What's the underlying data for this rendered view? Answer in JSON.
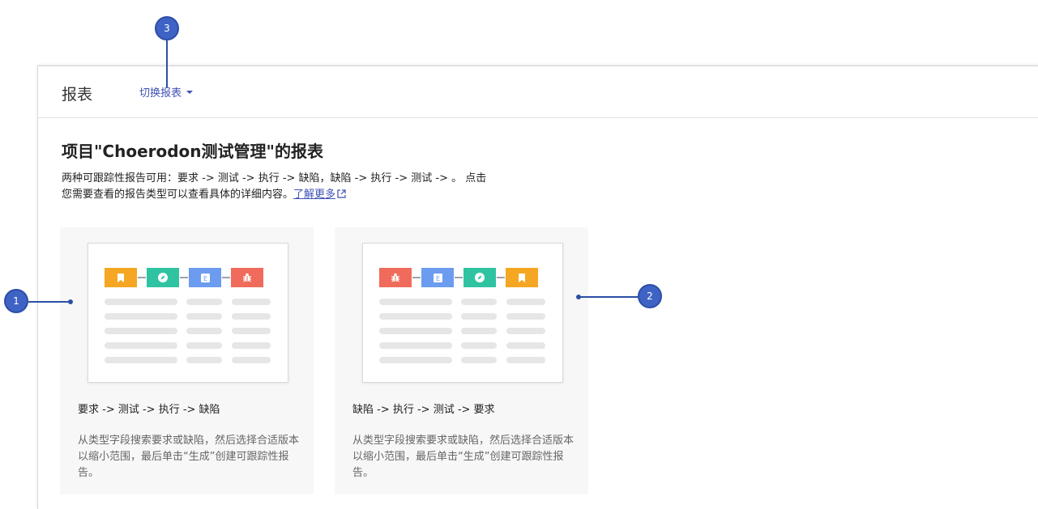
{
  "header": {
    "title": "报表",
    "switch_label": "切换报表"
  },
  "main": {
    "title": "项目\"Choerodon测试管理\"的报表",
    "desc_line1": "两种可跟踪性报告可用：要求 -> 测试 -> 执行 -> 缺陷，缺陷 -> 执行 -> 测试 -> 。 点击",
    "desc_line2": "您需要查看的报告类型可以查看具体的详细内容。",
    "learn_more": "了解更多"
  },
  "cards": [
    {
      "title": "要求 -> 测试 -> 执行 -> 缺陷",
      "description": "从类型字段搜索要求或缺陷，然后选择合适版本以缩小范围，最后单击“生成”创建可跟踪性报告。",
      "chain": [
        "bookmark-icon",
        "compass-icon",
        "e-icon",
        "bug-icon"
      ]
    },
    {
      "title": "缺陷 -> 执行 -> 测试 -> 要求",
      "description": "从类型字段搜索要求或缺陷，然后选择合适版本以缩小范围，最后单击“生成”创建可跟踪性报告。",
      "chain": [
        "bug-icon",
        "e-icon",
        "compass-icon",
        "bookmark-icon"
      ]
    }
  ],
  "icon_colors": {
    "bookmark": "#f5a623",
    "compass": "#2fc3a2",
    "e": "#6b9cf0",
    "bug": "#f06b5b"
  },
  "markers": [
    "1",
    "2",
    "3"
  ]
}
